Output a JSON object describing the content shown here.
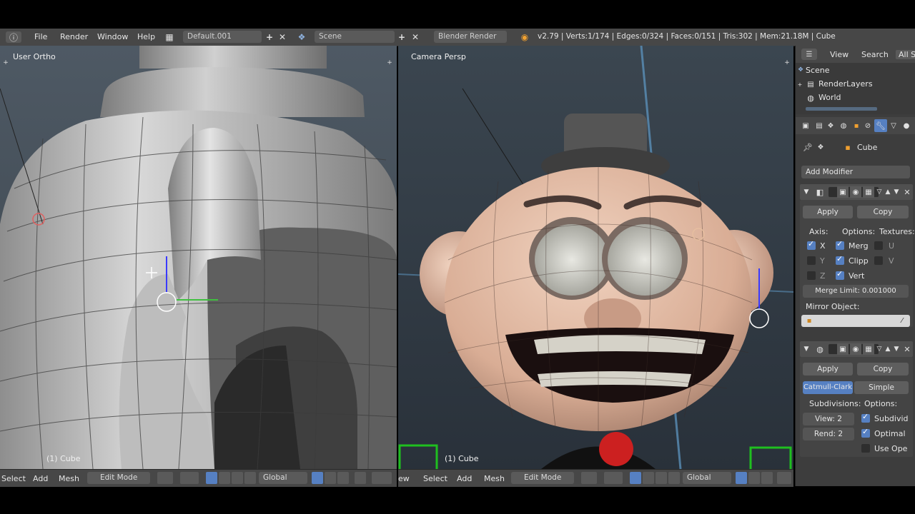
{
  "topbar": {
    "menus": [
      "File",
      "Render",
      "Window",
      "Help"
    ],
    "screen_layout": "Default.001",
    "scene": "Scene",
    "render_engine": "Blender Render",
    "stats": "v2.79 | Verts:1/174 | Edges:0/324 | Faces:0/151 | Tris:302 | Mem:21.18M | Cube"
  },
  "left_viewport": {
    "label": "User Ortho",
    "object": "(1) Cube"
  },
  "right_viewport": {
    "label": "Camera Persp",
    "object": "(1) Cube"
  },
  "left_header": {
    "menus": [
      "Select",
      "Add",
      "Mesh"
    ],
    "mode": "Edit Mode",
    "orientation": "Global"
  },
  "right_header": {
    "view_fragment": "ew",
    "menus": [
      "Select",
      "Add",
      "Mesh"
    ],
    "mode": "Edit Mode",
    "orientation": "Global"
  },
  "outliner": {
    "tabs": [
      "View",
      "Search",
      "All S"
    ],
    "items": [
      "Scene",
      "RenderLayers",
      "World"
    ]
  },
  "properties": {
    "object_name": "Cube",
    "add_modifier": "Add Modifier",
    "mirror": {
      "apply": "Apply",
      "copy": "Copy",
      "axis_label": "Axis:",
      "options_label": "Options:",
      "textures_label": "Textures:",
      "axes": [
        {
          "label": "X",
          "checked": true
        },
        {
          "label": "Y",
          "checked": false
        },
        {
          "label": "Z",
          "checked": false
        }
      ],
      "options": [
        {
          "label": "Merg",
          "checked": true
        },
        {
          "label": "Clipp",
          "checked": true
        },
        {
          "label": "Vert",
          "checked": true
        }
      ],
      "textures": [
        {
          "label": "U",
          "checked": false
        },
        {
          "label": "V",
          "checked": false
        }
      ],
      "merge_limit": "Merge Limit:  0.001000",
      "mirror_object": "Mirror Object:"
    },
    "subsurf": {
      "apply": "Apply",
      "copy": "Copy",
      "type_active": "Catmull-Clark",
      "type_other": "Simple",
      "subdivisions_label": "Subdivisions:",
      "options_label": "Options:",
      "view": "View:  2",
      "render": "Rend:  2",
      "options": [
        {
          "label": "Subdivid",
          "checked": true
        },
        {
          "label": "Optimal",
          "checked": true
        },
        {
          "label": "Use Ope",
          "checked": false
        }
      ]
    }
  }
}
